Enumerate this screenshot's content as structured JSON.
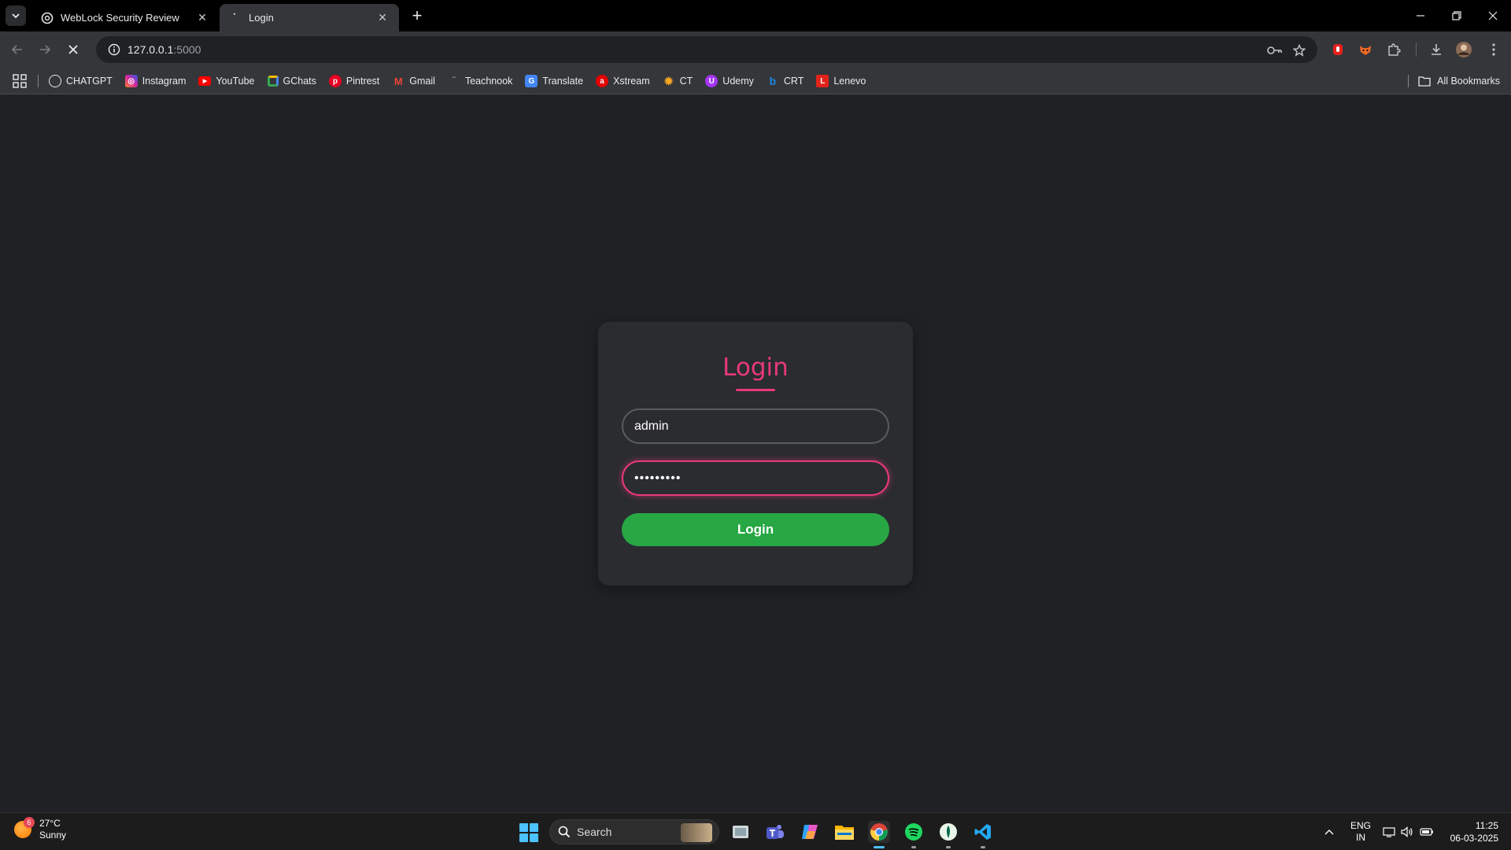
{
  "browser": {
    "tabs": [
      {
        "title": "WebLock Security Review",
        "icon": "chatgpt-icon",
        "active": false
      },
      {
        "title": "Login",
        "icon": "loading-spinner-icon",
        "active": true
      }
    ],
    "address": {
      "host": "127.0.0.1",
      "port": ":5000"
    },
    "bookmarks": [
      {
        "label": "CHATGPT",
        "icon": "chatgpt-icon",
        "color": "#ffffff"
      },
      {
        "label": "Instagram",
        "icon": "instagram-icon",
        "color": "#d6249f"
      },
      {
        "label": "YouTube",
        "icon": "youtube-icon",
        "color": "#ff0000"
      },
      {
        "label": "GChats",
        "icon": "google-chat-icon",
        "color": "#34a853"
      },
      {
        "label": "Pintrest",
        "icon": "pinterest-icon",
        "color": "#e60023"
      },
      {
        "label": "Gmail",
        "icon": "gmail-icon",
        "color": "#ea4335"
      },
      {
        "label": "Teachnook",
        "icon": "teachnook-icon",
        "color": "#444444"
      },
      {
        "label": "Translate",
        "icon": "google-translate-icon",
        "color": "#4285f4"
      },
      {
        "label": "Xstream",
        "icon": "airtel-xstream-icon",
        "color": "#e40000"
      },
      {
        "label": "CT",
        "icon": "ct-gear-icon",
        "color": "#f5a623"
      },
      {
        "label": "Udemy",
        "icon": "udemy-icon",
        "color": "#a435f0"
      },
      {
        "label": "CRT",
        "icon": "crt-icon",
        "color": "#1e88e5"
      },
      {
        "label": "Lenevo",
        "icon": "lenovo-icon",
        "color": "#e2231a"
      }
    ],
    "all_bookmarks": "All Bookmarks"
  },
  "page": {
    "heading": "Login",
    "username_value": "admin",
    "password_value": "•••••••••",
    "login_button": "Login",
    "accent": "#e8397a",
    "button_color": "#28a745"
  },
  "taskbar": {
    "weather": {
      "temp": "27°C",
      "condition": "Sunny",
      "badge": "6"
    },
    "search_label": "Search",
    "lang_top": "ENG",
    "lang_bottom": "IN",
    "time": "11:25",
    "date": "06-03-2025"
  }
}
